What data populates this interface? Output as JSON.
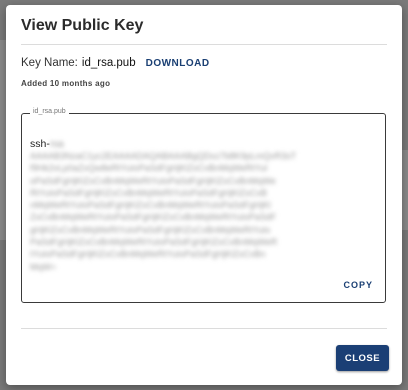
{
  "dialog": {
    "title": "View Public Key",
    "key_label": "Key Name:",
    "key_name": "id_rsa.pub",
    "download_label": "DOWNLOAD",
    "added_text": "Added 10 months ago",
    "field_legend": "id_rsa.pub",
    "key_prefix": "ssh-",
    "copy_label": "COPY",
    "close_label": "CLOSE"
  },
  "colors": {
    "accent": "#1a3f73",
    "overlay": "#7a7a7a",
    "close_button": "#1b3f75"
  }
}
